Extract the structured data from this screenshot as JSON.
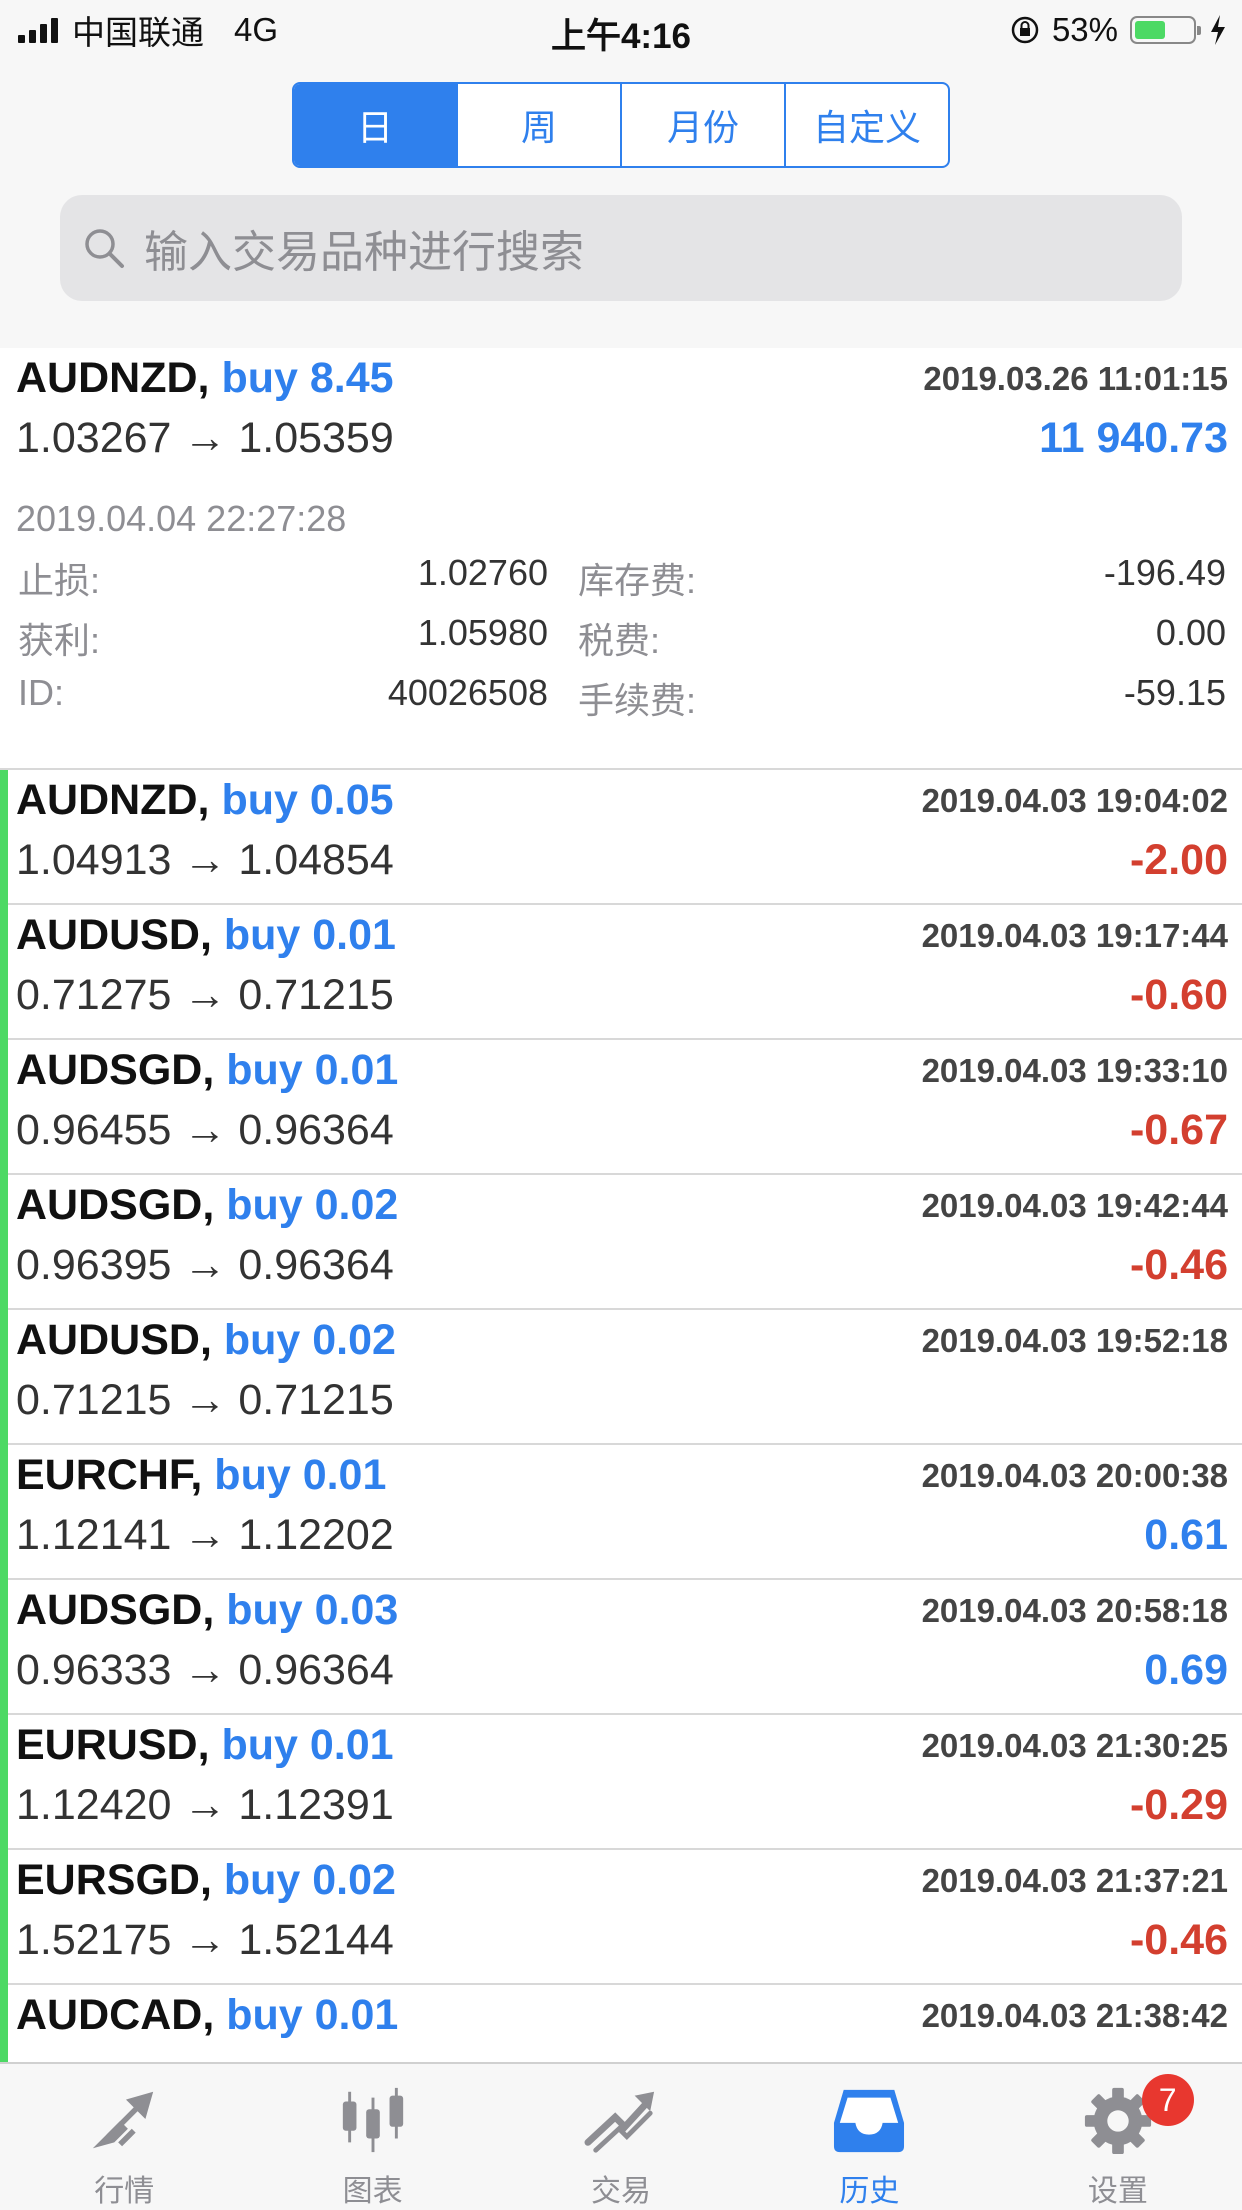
{
  "status_bar": {
    "carrier": "中国联通",
    "network": "4G",
    "time": "上午4:16",
    "battery_pct": "53%",
    "battery_level": 0.53
  },
  "segments": [
    "日",
    "周",
    "月份",
    "自定义"
  ],
  "active_segment": "日",
  "search": {
    "placeholder": "输入交易品种进行搜索"
  },
  "open_card": {
    "symbol": "AUDNZD,",
    "side": "buy 8.45",
    "open_time": "2019.03.26 11:01:15",
    "prices": "1.03267 → 1.05359",
    "profit": "11 940.73",
    "close_time": "2019.04.04 22:27:28",
    "details": {
      "sl_label": "止损:",
      "sl": "1.02760",
      "tp_label": "获利:",
      "tp": "1.05980",
      "id_label": "ID:",
      "id": "40026508",
      "swap_label": "库存费:",
      "swap": "-196.49",
      "tax_label": "税费:",
      "tax": "0.00",
      "fee_label": "手续费:",
      "fee": "-59.15"
    }
  },
  "trades": [
    {
      "symbol": "AUDNZD,",
      "side": "buy 0.05",
      "time": "2019.04.03 19:04:02",
      "prices": "1.04913 → 1.04854",
      "profit": "-2.00"
    },
    {
      "symbol": "AUDUSD,",
      "side": "buy 0.01",
      "time": "2019.04.03 19:17:44",
      "prices": "0.71275 → 0.71215",
      "profit": "-0.60"
    },
    {
      "symbol": "AUDSGD,",
      "side": "buy 0.01",
      "time": "2019.04.03 19:33:10",
      "prices": "0.96455 → 0.96364",
      "profit": "-0.67"
    },
    {
      "symbol": "AUDSGD,",
      "side": "buy 0.02",
      "time": "2019.04.03 19:42:44",
      "prices": "0.96395 → 0.96364",
      "profit": "-0.46"
    },
    {
      "symbol": "AUDUSD,",
      "side": "buy 0.02",
      "time": "2019.04.03 19:52:18",
      "prices": "0.71215 → 0.71215",
      "profit": ""
    },
    {
      "symbol": "EURCHF,",
      "side": "buy 0.01",
      "time": "2019.04.03 20:00:38",
      "prices": "1.12141 → 1.12202",
      "profit": "0.61"
    },
    {
      "symbol": "AUDSGD,",
      "side": "buy 0.03",
      "time": "2019.04.03 20:58:18",
      "prices": "0.96333 → 0.96364",
      "profit": "0.69"
    },
    {
      "symbol": "EURUSD,",
      "side": "buy 0.01",
      "time": "2019.04.03 21:30:25",
      "prices": "1.12420 → 1.12391",
      "profit": "-0.29"
    },
    {
      "symbol": "EURSGD,",
      "side": "buy 0.02",
      "time": "2019.04.03 21:37:21",
      "prices": "1.52175 → 1.52144",
      "profit": "-0.46"
    },
    {
      "symbol": "AUDCAD,",
      "side": "buy 0.01",
      "time": "2019.04.03 21:38:42",
      "prices": "",
      "profit": ""
    }
  ],
  "tabs": [
    {
      "label": "行情",
      "icon": "quotes-icon"
    },
    {
      "label": "图表",
      "icon": "chart-icon"
    },
    {
      "label": "交易",
      "icon": "trade-icon"
    },
    {
      "label": "历史",
      "icon": "history-icon"
    },
    {
      "label": "设置",
      "icon": "settings-icon",
      "badge": "7"
    }
  ],
  "active_tab": "历史",
  "colors": {
    "accent": "#2f80ed",
    "loss": "#d33f2f",
    "row_marker": "#4cd964",
    "badge": "#e8372f"
  }
}
